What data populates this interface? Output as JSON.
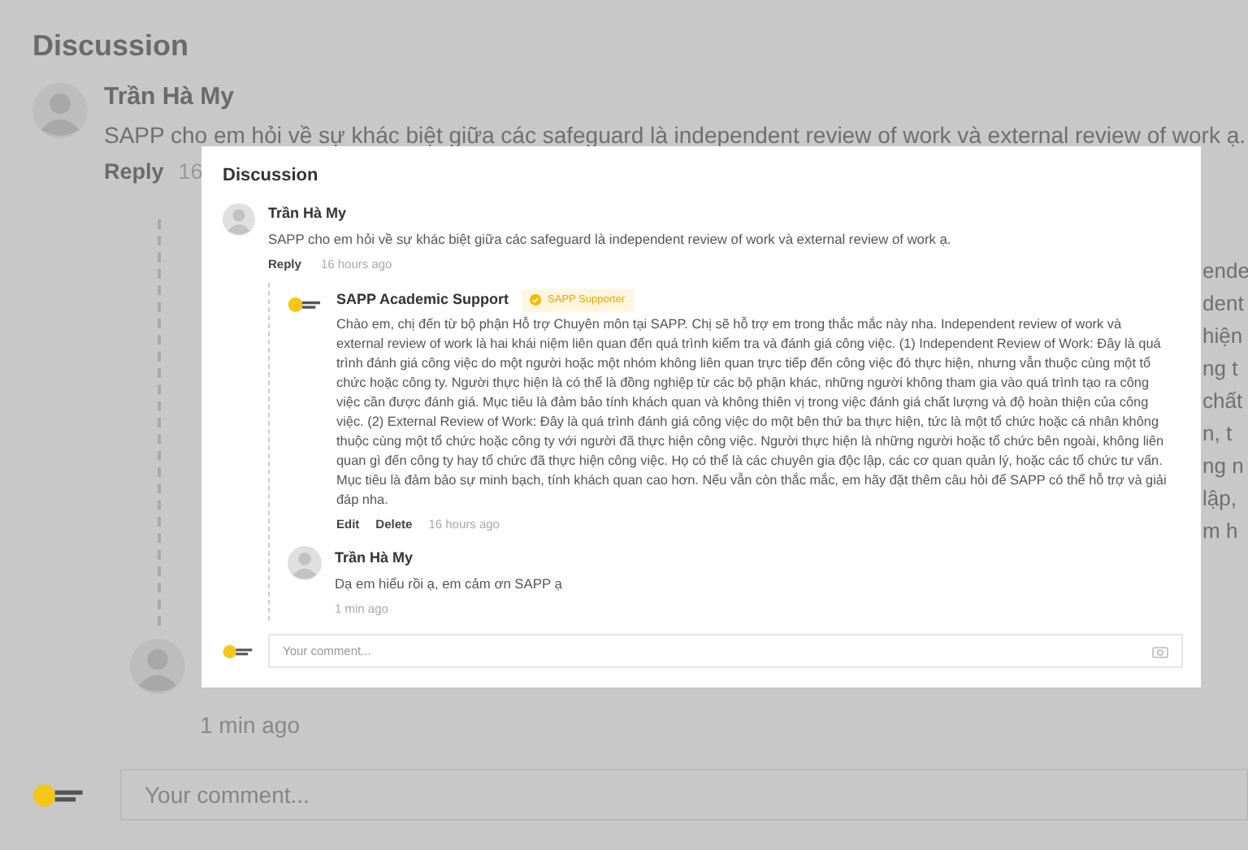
{
  "backdrop": {
    "title": "Discussion",
    "comment": {
      "author": "Trần Hà My",
      "text": "SAPP cho em hỏi về sự khác biệt giữa các safeguard là independent review of work và external review of work ạ.",
      "reply_label": "Reply",
      "time": "16"
    },
    "text_fragments": [
      "ende",
      "dent",
      "hiện",
      "ng t",
      "chất",
      "n, t",
      "ng n",
      "lập,",
      "m h"
    ],
    "reply_time": "1 min ago",
    "comment_field": {
      "placeholder": "Your comment..."
    }
  },
  "dialog": {
    "title": "Discussion",
    "comment": {
      "author": "Trần Hà My",
      "text": "SAPP cho em hỏi về sự khác biệt giữa các safeguard là independent review of work và external review of work ạ.",
      "reply_label": "Reply",
      "time": "16 hours ago",
      "replies": [
        {
          "kind": "support",
          "author": "SAPP Academic Support",
          "badge": "SAPP Supporter",
          "text": "Chào em, chị đến từ bộ phận Hỗ trợ Chuyên môn tại SAPP. Chị sẽ hỗ trợ em trong thắc mắc này nha. Independent review of work và external review of work là hai khái niệm liên quan đến quá trình kiểm tra và đánh giá công việc. (1) Independent Review of Work: Đây là quá trình đánh giá công việc do một người hoặc một nhóm không liên quan trực tiếp đến công việc đó thực hiện, nhưng vẫn thuộc cùng một tổ chức hoặc công ty. Người thực hiện là có thể là đồng nghiệp từ các bộ phận khác, những người không tham gia vào quá trình tạo ra công việc cần được đánh giá. Mục tiêu là đảm bảo tính khách quan và không thiên vị trong việc đánh giá chất lượng và độ hoàn thiện của công việc. (2) External Review of Work: Đây là quá trình đánh giá công việc do một bên thứ ba thực hiện, tức là một tổ chức hoặc cá nhân không thuộc cùng một tổ chức hoặc công ty với người đã thực hiện công việc. Người thực hiện là những người hoặc tổ chức bên ngoài, không liên quan gì đến công ty hay tổ chức đã thực hiện công việc. Họ có thể là các chuyên gia độc lập, các cơ quan quản lý, hoặc các tổ chức tư vấn. Mục tiêu là đảm bảo sự minh bạch, tính khách quan cao hơn. Nếu vẫn còn thắc mắc, em hãy đặt thêm câu hỏi để SAPP có thể hỗ trợ và giải đáp nha.",
          "actions": [
            "Edit",
            "Delete"
          ],
          "time": "16 hours ago"
        },
        {
          "kind": "user",
          "author": "Trần Hà My",
          "text": "Dạ em hiểu rồi ạ, em cảm ơn SAPP ạ",
          "time": "1 min ago"
        }
      ]
    },
    "comment_field": {
      "placeholder": "Your comment..."
    }
  }
}
